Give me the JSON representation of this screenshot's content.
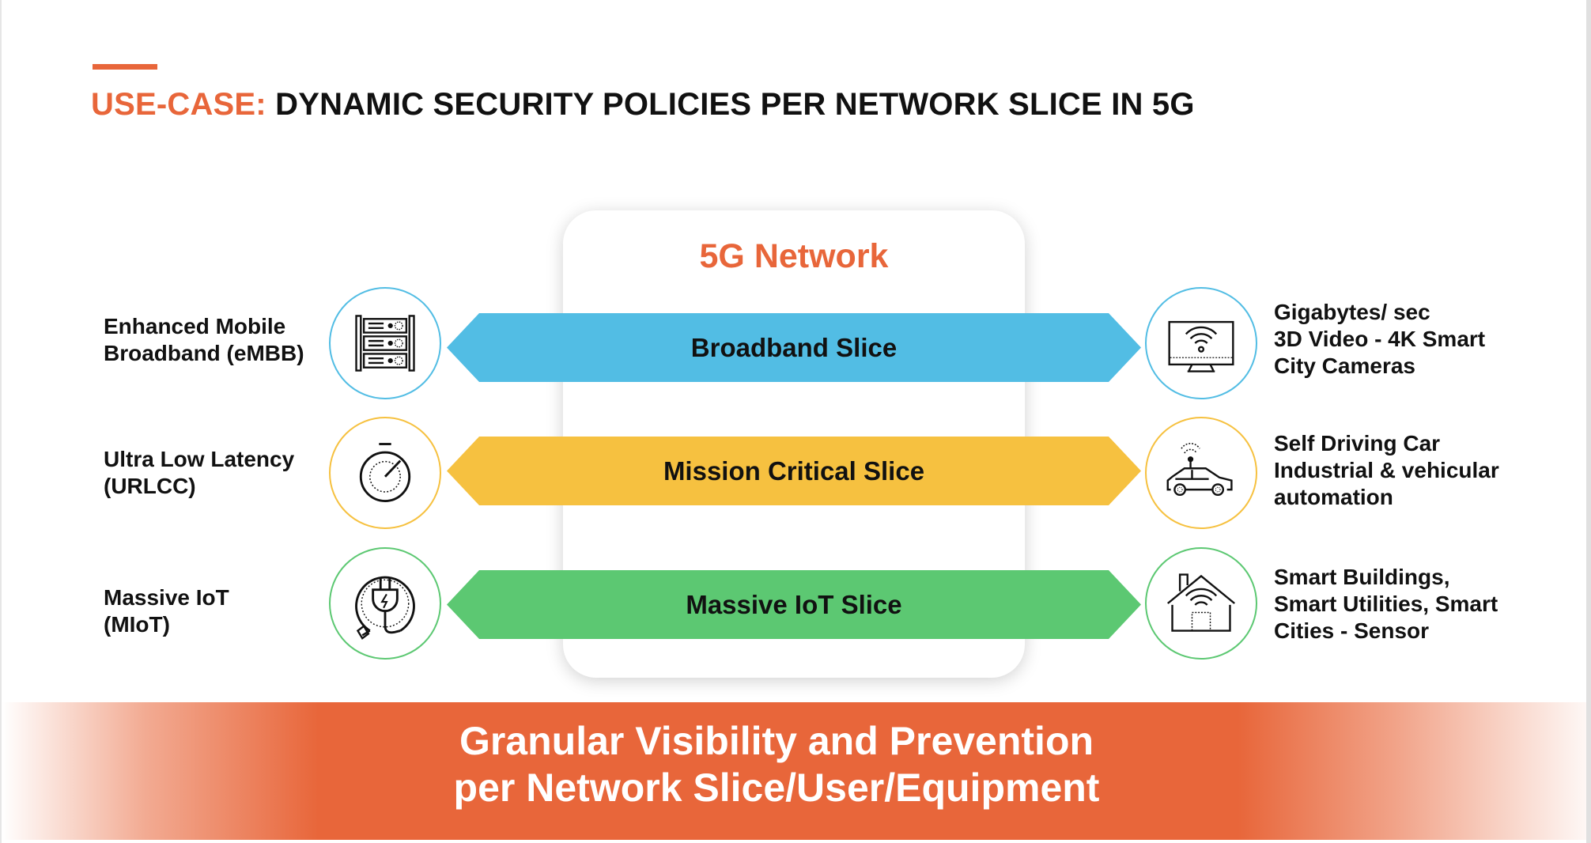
{
  "theme": {
    "accent": "#E8663A",
    "broadband_color": "#52BDE4",
    "mission_color": "#F6C140",
    "iot_color": "#5CC872"
  },
  "header": {
    "title_prefix": "USE-CASE:",
    "title_rest": "DYNAMIC SECURITY POLICIES PER NETWORK SLICE IN 5G"
  },
  "network": {
    "title": "5G Network"
  },
  "slices": [
    {
      "label": "Broadband Slice",
      "left_lines": [
        "Enhanced Mobile",
        "Broadband (eMBB)"
      ],
      "left_icon": "server-rack-icon",
      "right_icon": "smart-tv-wifi-icon",
      "right_lines": [
        "Gigabytes/ sec",
        "3D Video - 4K Smart",
        "City Cameras"
      ]
    },
    {
      "label": "Mission Critical Slice",
      "left_lines": [
        "Ultra Low Latency",
        "(URLCC)"
      ],
      "left_icon": "stopwatch-icon",
      "right_icon": "connected-car-icon",
      "right_lines": [
        "Self Driving Car",
        "Industrial & vehicular",
        "automation"
      ]
    },
    {
      "label": "Massive IoT Slice",
      "left_lines": [
        "Massive IoT",
        "(MIoT)"
      ],
      "left_icon": "power-plug-icon",
      "right_icon": "smart-house-icon",
      "right_lines": [
        "Smart Buildings,",
        "Smart Utilities, Smart",
        "Cities - Sensor"
      ]
    }
  ],
  "banner": {
    "line1": "Granular Visibility and Prevention",
    "line2": "per Network Slice/User/Equipment"
  }
}
